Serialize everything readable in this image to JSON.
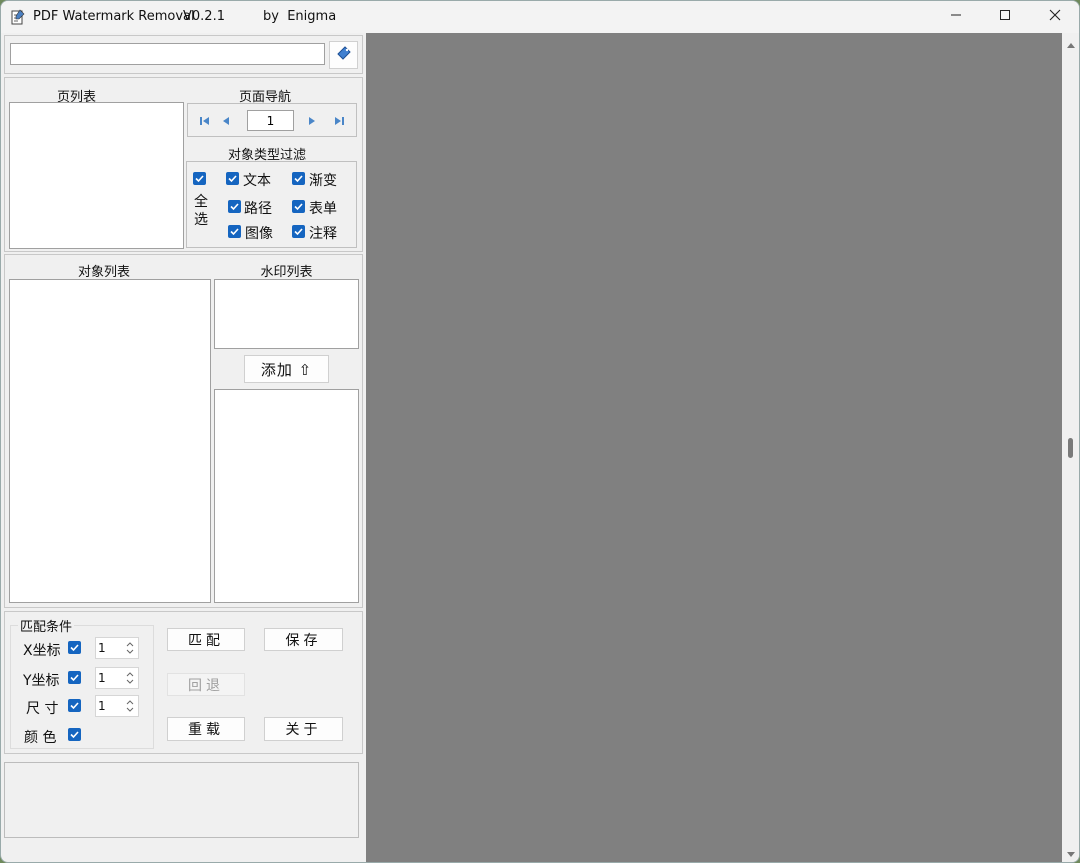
{
  "window": {
    "app_name": "PDF Watermark Removal",
    "version": "V0.2.1",
    "author": "by  Enigma"
  },
  "file": {
    "path_value": ""
  },
  "sections": {
    "page_list": "页列表",
    "page_nav": "页面导航",
    "type_filter": "对象类型过滤",
    "object_list": "对象列表",
    "watermark_list": "水印列表",
    "match_conditions": "匹配条件"
  },
  "nav": {
    "page_number": "1"
  },
  "filter": {
    "select_all_line1": "全",
    "select_all_line2": "选",
    "items": [
      {
        "label": "文本",
        "checked": true
      },
      {
        "label": "渐变",
        "checked": true
      },
      {
        "label": "路径",
        "checked": true
      },
      {
        "label": "表单",
        "checked": true
      },
      {
        "label": "图像",
        "checked": true
      },
      {
        "label": "注释",
        "checked": true
      }
    ]
  },
  "watermark": {
    "add_label": "添加 ⇧"
  },
  "match": {
    "x_label": "X坐标",
    "x_value": "1",
    "y_label": "Y坐标",
    "y_value": "1",
    "size_label": "尺 寸",
    "size_value": "1",
    "color_label": "颜 色"
  },
  "buttons": {
    "match": "匹配",
    "save": "保存",
    "undo": "回退",
    "reload": "重载",
    "about": "关于"
  },
  "colors": {
    "accent": "#1565c0",
    "preview_bg": "#808080"
  },
  "icons": [
    "app-icon",
    "open-file-icon",
    "first-page-icon",
    "prev-page-icon",
    "next-page-icon",
    "last-page-icon",
    "minimize-icon",
    "maximize-icon",
    "close-icon"
  ]
}
